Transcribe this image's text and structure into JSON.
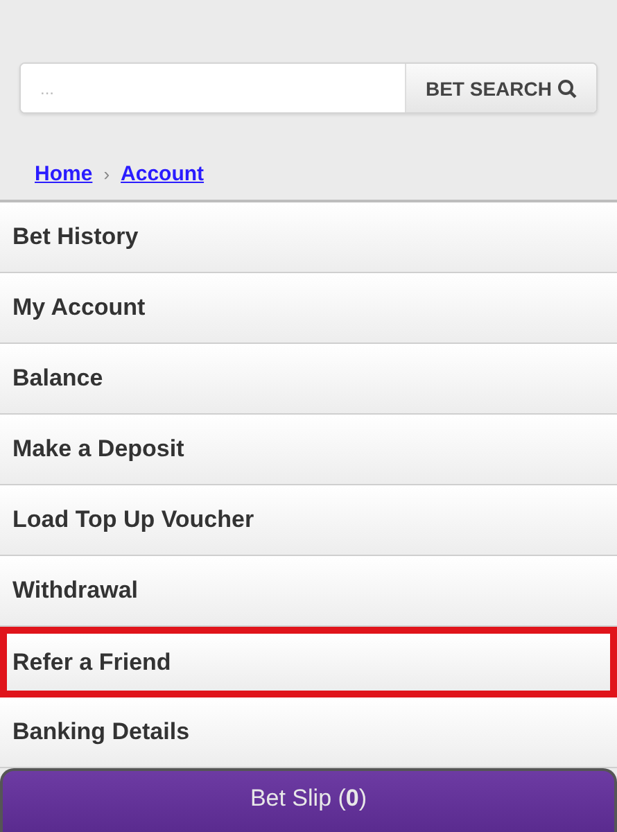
{
  "search": {
    "placeholder": "...",
    "button": "BET SEARCH"
  },
  "breadcrumb": [
    {
      "label": "Home"
    },
    {
      "label": "Account"
    }
  ],
  "breadcrumb_separator": "›",
  "menu": [
    {
      "label": "Bet History",
      "highlighted": false
    },
    {
      "label": "My Account",
      "highlighted": false
    },
    {
      "label": "Balance",
      "highlighted": false
    },
    {
      "label": "Make a Deposit",
      "highlighted": false
    },
    {
      "label": "Load Top Up Voucher",
      "highlighted": false
    },
    {
      "label": "Withdrawal",
      "highlighted": false
    },
    {
      "label": "Refer a Friend",
      "highlighted": true
    },
    {
      "label": "Banking Details",
      "highlighted": false
    }
  ],
  "bet_slip": "Bet Slip (**0**)"
}
